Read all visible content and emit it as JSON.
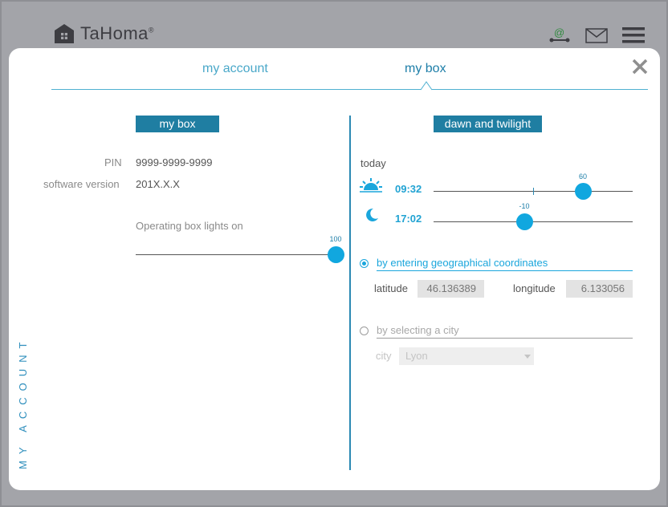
{
  "app": {
    "brand": "TaHoma",
    "reg_mark": "®"
  },
  "header_icons": [
    "email-config-icon",
    "mail-icon",
    "menu-icon"
  ],
  "tabs": [
    {
      "label": "my account",
      "active": false
    },
    {
      "label": "my box",
      "active": true
    }
  ],
  "side_label": "MY ACCOUNT",
  "my_box": {
    "title": "my box",
    "pin_label": "PIN",
    "pin_value": "9999-9999-9999",
    "software_label": "software version",
    "software_value": "201X.X.X",
    "lights_label": "Operating box lights on",
    "lights_value": "100",
    "lights_level_pct": 100
  },
  "dawn": {
    "title": "dawn and twilight",
    "today_label": "today",
    "sunrise_time": "09:32",
    "sunrise_offset": "60",
    "sunset_time": "17:02",
    "sunset_offset": "-10",
    "option_coords": "by entering geographical coordinates",
    "latitude_label": "latitude",
    "latitude_value": "46.136389",
    "longitude_label": "longitude",
    "longitude_value": "6.133056",
    "option_city": "by selecting a city",
    "city_label": "city",
    "city_value": "Lyon"
  },
  "colors": {
    "accent": "#11a7df",
    "section_bg": "#1f7ea2",
    "overlay": "#a3a4a9"
  }
}
